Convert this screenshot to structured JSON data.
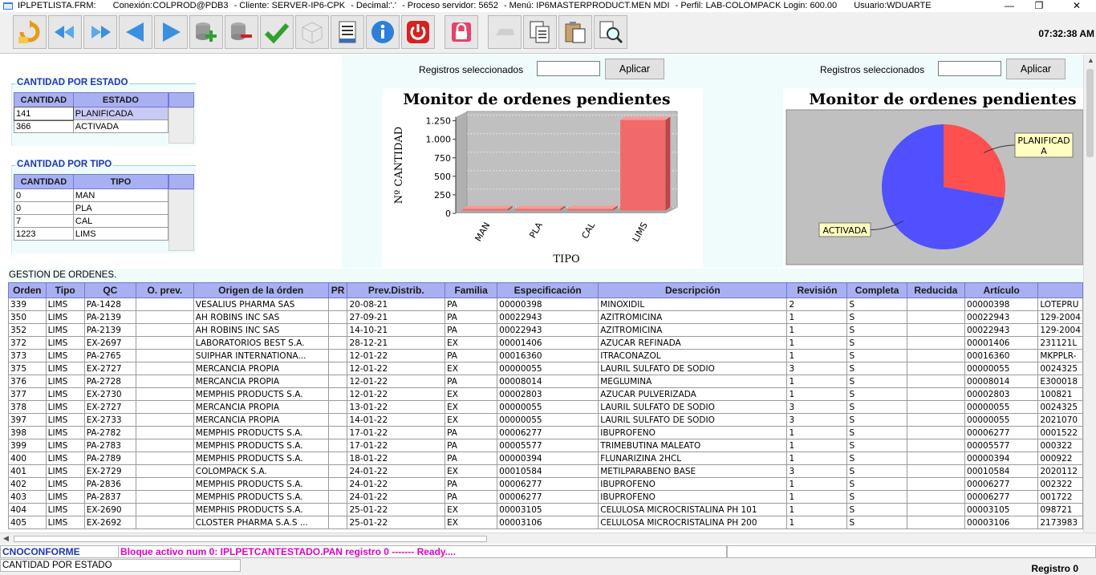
{
  "titlebar": {
    "form": "IPLPETLISTA.FRM:",
    "conexion": "Conexión:COLPROD@PDB3",
    "cliente": "- Cliente: SERVER-IP6-CPK",
    "decimal": "- Decimal:'.'",
    "proceso": "- Proceso servidor: 5652",
    "menu": "- Menú: IP6MASTERPRODUCT.MEN MDI",
    "perfil": "- Perfil: LAB-COLOMPACK Login: 600.00",
    "usuario": "Usuario:WDUARTE",
    "minimize": "—",
    "maximize": "❐",
    "close": "✕"
  },
  "toolbar": {
    "clock": "07:32:38 AM",
    "icons": [
      "refresh-icon",
      "first-record-icon",
      "last-record-icon",
      "previous-icon",
      "next-icon",
      "add-record-icon",
      "delete-record-icon",
      "accept-check-icon",
      "cube-icon",
      "report-icon",
      "info-icon",
      "power-icon",
      "lock-icon",
      "disabled-icon",
      "copy-icon",
      "paste-icon",
      "search-icon"
    ]
  },
  "estado": {
    "title": "CANTIDAD POR ESTADO",
    "headers": [
      "CANTIDAD",
      "ESTADO"
    ],
    "rows": [
      [
        "141",
        "PLANIFICADA"
      ],
      [
        "366",
        "ACTIVADA"
      ]
    ]
  },
  "tipo": {
    "title": "CANTIDAD POR TIPO",
    "headers": [
      "CANTIDAD",
      "TIPO"
    ],
    "rows": [
      [
        "0",
        "MAN"
      ],
      [
        "0",
        "PLA"
      ],
      [
        "7",
        "CAL"
      ],
      [
        "1223",
        "LIMS"
      ]
    ]
  },
  "selection": {
    "label1": "Registros seleccionados",
    "label2": "Registros seleccionados",
    "value1": "",
    "value2": "",
    "apply1": "Aplicar",
    "apply2": "Aplicar"
  },
  "chart_data": [
    {
      "type": "bar",
      "title": "Monitor de ordenes pendientes",
      "xlabel": "TIPO",
      "ylabel": "Nº CANTIDAD",
      "categories": [
        "MAN",
        "PLA",
        "CAL",
        "LIMS"
      ],
      "values": [
        0,
        0,
        7,
        1223
      ],
      "ylim": [
        0,
        1300
      ],
      "yticks": [
        "0",
        "250",
        "500",
        "750",
        "1.000",
        "1.250"
      ],
      "color": "#f06a6a",
      "grid": true
    },
    {
      "type": "pie",
      "title": "Monitor de ordenes pendientes",
      "labels": [
        "PLANIFICADA",
        "ACTIVADA"
      ],
      "label_lines": [
        [
          "PLANIFICAD",
          "A"
        ],
        [
          "ACTIVADA"
        ]
      ],
      "values": [
        141,
        366
      ],
      "colors": [
        "#ff5050",
        "#5050ff"
      ]
    }
  ],
  "grid": {
    "caption": "GESTION DE ORDENES.",
    "headers": [
      "Orden",
      "Tipo",
      "QC",
      "O. prev.",
      "Origen de la órden",
      "PR",
      "Prev.Distrib.",
      "Familia",
      "Especificación",
      "Descripción",
      "Revisión",
      "Completa",
      "Reducida",
      "Artículo",
      ""
    ],
    "rows": [
      [
        "339",
        "LIMS",
        "PA-1428",
        "",
        "VESALIUS PHARMA SAS",
        "",
        "20-08-21",
        "PA",
        "00000398",
        "MINOXIDIL",
        "2",
        "S",
        "",
        "00000398",
        "LOTEPRU"
      ],
      [
        "350",
        "LIMS",
        "PA-2139",
        "",
        "AH ROBINS INC SAS",
        "",
        "27-09-21",
        "PA",
        "00022943",
        "AZITROMICINA",
        "1",
        "S",
        "",
        "00022943",
        "129-2004"
      ],
      [
        "352",
        "LIMS",
        "PA-2139",
        "",
        "AH ROBINS INC SAS",
        "",
        "14-10-21",
        "PA",
        "00022943",
        "AZITROMICINA",
        "1",
        "S",
        "",
        "00022943",
        "129-2004"
      ],
      [
        "372",
        "LIMS",
        "EX-2697",
        "",
        "LABORATORIOS BEST S.A.",
        "",
        "28-12-21",
        "EX",
        "00001406",
        "AZUCAR REFINADA",
        "1",
        "S",
        "",
        "00001406",
        "231121L"
      ],
      [
        "373",
        "LIMS",
        "PA-2765",
        "",
        "SUIPHAR INTERNATIONA...",
        "",
        "12-01-22",
        "PA",
        "00016360",
        "ITRACONAZOL",
        "1",
        "S",
        "",
        "00016360",
        "MKPPLR-"
      ],
      [
        "375",
        "LIMS",
        "EX-2727",
        "",
        "MERCANCIA PROPIA",
        "",
        "12-01-22",
        "EX",
        "00000055",
        "LAURIL SULFATO DE SODIO",
        "3",
        "S",
        "",
        "00000055",
        "0024325"
      ],
      [
        "376",
        "LIMS",
        "PA-2728",
        "",
        "MERCANCIA PROPIA",
        "",
        "12-01-22",
        "PA",
        "00008014",
        "MEGLUMINA",
        "1",
        "S",
        "",
        "00008014",
        "E300018"
      ],
      [
        "377",
        "LIMS",
        "EX-2730",
        "",
        "MEMPHIS PRODUCTS S.A.",
        "",
        "12-01-22",
        "EX",
        "00002803",
        "AZUCAR PULVERIZADA",
        "1",
        "S",
        "",
        "00002803",
        "100821"
      ],
      [
        "378",
        "LIMS",
        "EX-2727",
        "",
        "MERCANCIA PROPIA",
        "",
        "13-01-22",
        "EX",
        "00000055",
        "LAURIL SULFATO DE SODIO",
        "3",
        "S",
        "",
        "00000055",
        "0024325"
      ],
      [
        "397",
        "LIMS",
        "EX-2733",
        "",
        "MERCANCIA PROPIA",
        "",
        "14-01-22",
        "EX",
        "00000055",
        "LAURIL SULFATO DE SODIO",
        "3",
        "S",
        "",
        "00000055",
        "2021070"
      ],
      [
        "398",
        "LIMS",
        "PA-2782",
        "",
        "MEMPHIS PRODUCTS S.A.",
        "",
        "17-01-22",
        "PA",
        "00006277",
        "IBUPROFENO",
        "1",
        "S",
        "",
        "00006277",
        "0001522"
      ],
      [
        "399",
        "LIMS",
        "PA-2783",
        "",
        "MEMPHIS PRODUCTS S.A.",
        "",
        "17-01-22",
        "PA",
        "00005577",
        "TRIMEBUTINA MALEATO",
        "1",
        "S",
        "",
        "00005577",
        "000322"
      ],
      [
        "400",
        "LIMS",
        "PA-2789",
        "",
        "MEMPHIS PRODUCTS S.A.",
        "",
        "18-01-22",
        "PA",
        "00000394",
        "FLUNARIZINA 2HCL",
        "1",
        "S",
        "",
        "00000394",
        "000922"
      ],
      [
        "401",
        "LIMS",
        "EX-2729",
        "",
        "COLOMPACK S.A.",
        "",
        "24-01-22",
        "EX",
        "00010584",
        "METILPARABENO BASE",
        "3",
        "S",
        "",
        "00010584",
        "2020112"
      ],
      [
        "402",
        "LIMS",
        "PA-2836",
        "",
        "MEMPHIS PRODUCTS S.A.",
        "",
        "24-01-22",
        "PA",
        "00006277",
        "IBUPROFENO",
        "1",
        "S",
        "",
        "00006277",
        "002322"
      ],
      [
        "403",
        "LIMS",
        "PA-2837",
        "",
        "MEMPHIS PRODUCTS S.A.",
        "",
        "24-01-22",
        "PA",
        "00006277",
        "IBUPROFENO",
        "1",
        "S",
        "",
        "00006277",
        "001722"
      ],
      [
        "404",
        "LIMS",
        "EX-2690",
        "",
        "MEMPHIS PRODUCTS S.A.",
        "",
        "25-01-22",
        "EX",
        "00003105",
        "CELULOSA MICROCRISTALINA PH 101",
        "1",
        "S",
        "",
        "00003105",
        "098721"
      ],
      [
        "405",
        "LIMS",
        "EX-2692",
        "",
        "CLOSTER PHARMA S.A.S ...",
        "",
        "25-01-22",
        "EX",
        "00003106",
        "CELULOSA MICROCRISTALINA PH 200",
        "1",
        "S",
        "",
        "00003106",
        "2173983"
      ]
    ]
  },
  "status": {
    "form": "CNOCONFORME",
    "message": "Bloque activo num 0: IPLPETCANTESTADO.PAN  registro 0 ------- Ready....",
    "block": "CANTIDAD POR ESTADO",
    "registro": "Registro 0"
  }
}
